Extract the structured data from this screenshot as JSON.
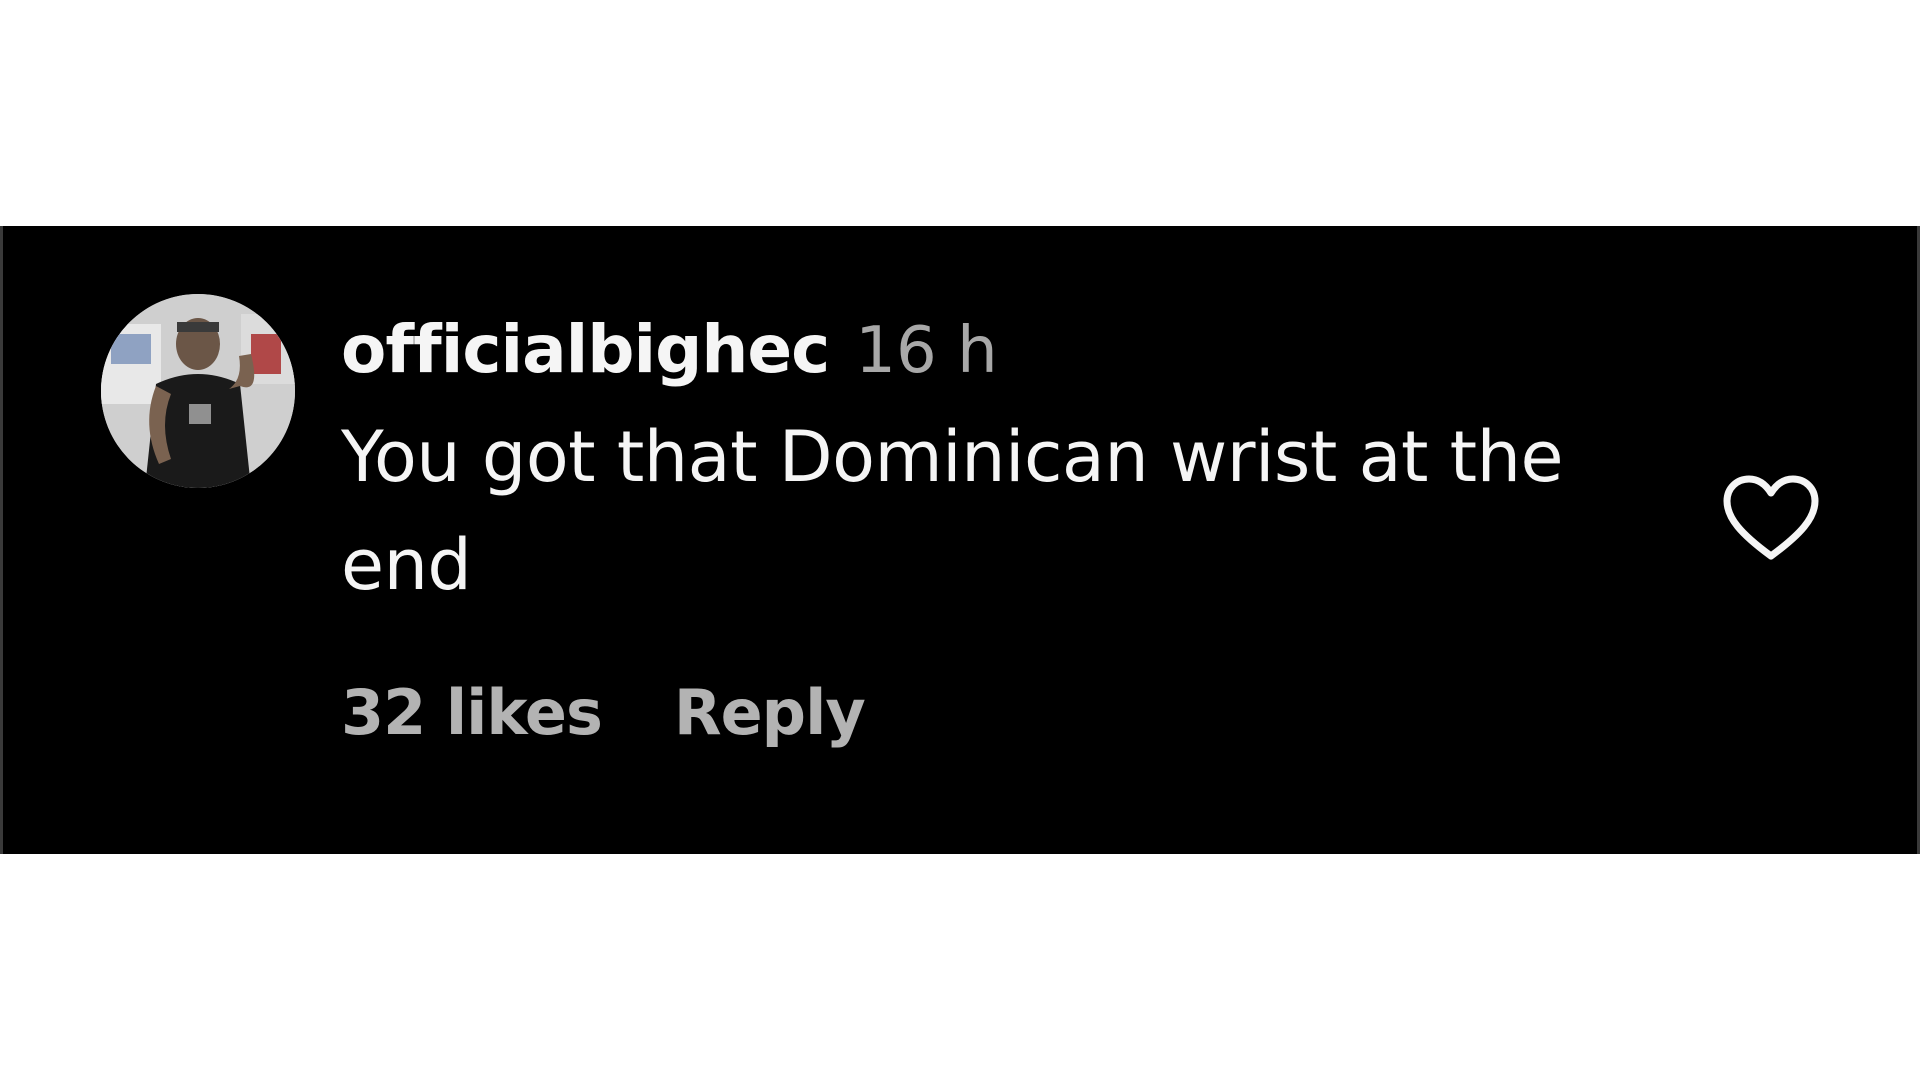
{
  "comment": {
    "username": "officialbighec",
    "timestamp": "16 h",
    "text": "You got that Dominican wrist at the end",
    "likes": "32 likes",
    "reply_label": "Reply"
  },
  "icons": {
    "like": "heart-outline-icon",
    "avatar": "user-avatar"
  },
  "colors": {
    "background": "#000000",
    "primary_text": "#f5f5f5",
    "secondary_text": "#a8a8a8"
  }
}
